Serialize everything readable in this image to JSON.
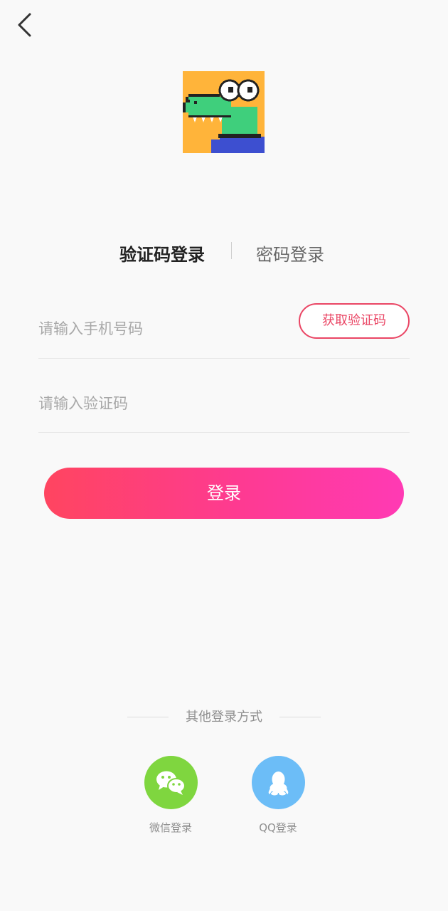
{
  "header": {
    "back_icon": "chevron-left-icon"
  },
  "logo": {
    "icon": "crocodile-logo",
    "colors": {
      "background": "#ffb43a",
      "body": "#3fcf7c",
      "shirt": "#3d4fd0"
    }
  },
  "tabs": [
    {
      "label": "验证码登录",
      "active": true
    },
    {
      "label": "密码登录",
      "active": false
    }
  ],
  "form": {
    "phone_placeholder": "请输入手机号码",
    "phone_value": "",
    "code_placeholder": "请输入验证码",
    "code_value": "",
    "get_code_label": "获取验证码",
    "login_label": "登录"
  },
  "other_login": {
    "title": "其他登录方式",
    "methods": [
      {
        "label": "微信登录",
        "icon": "wechat-icon",
        "color": "#7fd63f"
      },
      {
        "label": "QQ登录",
        "icon": "qq-icon",
        "color": "#6cbdf7"
      }
    ]
  },
  "colors": {
    "accent": "#ea4564",
    "button_gradient_start": "#ff4560",
    "button_gradient_end": "#ff3ab4"
  }
}
